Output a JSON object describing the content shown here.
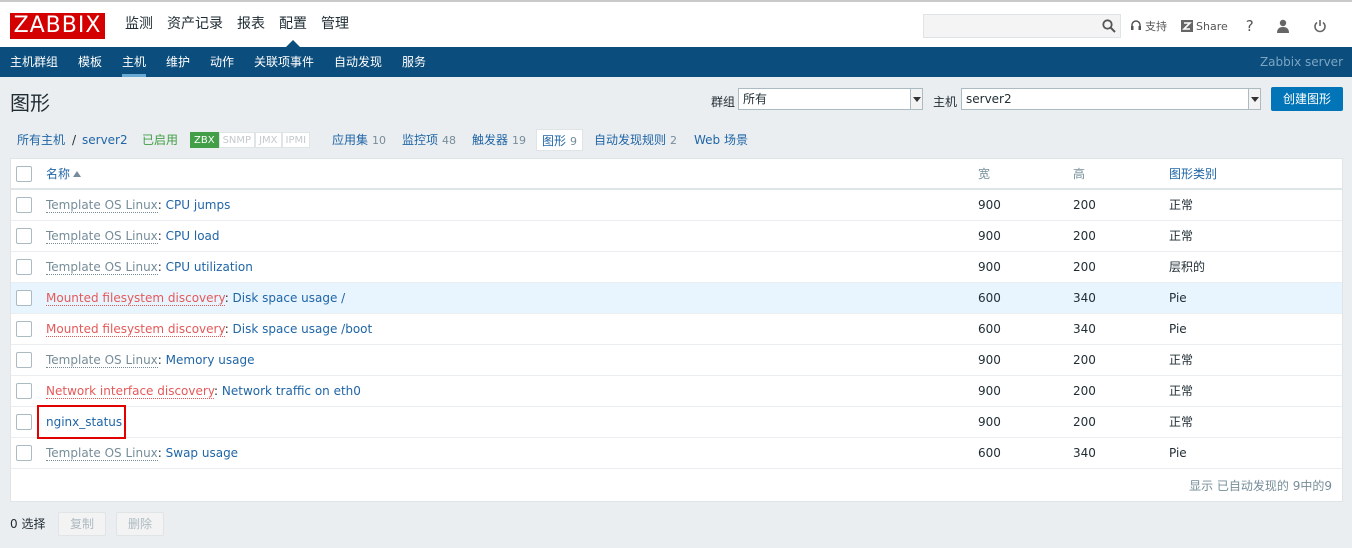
{
  "header": {
    "logo": "ZABBIX",
    "menu": [
      "监测",
      "资产记录",
      "报表",
      "配置",
      "管理"
    ],
    "selected_menu": "配置",
    "support": "支持",
    "share": "Share",
    "help": "?"
  },
  "nav": {
    "items": [
      "主机群组",
      "模板",
      "主机",
      "维护",
      "动作",
      "关联项事件",
      "自动发现",
      "服务"
    ],
    "selected": "主机",
    "server_name": "Zabbix server"
  },
  "page": {
    "title": "图形",
    "group_label": "群组",
    "group_value": "所有",
    "host_label": "主机",
    "host_value": "server2",
    "create_button": "创建图形"
  },
  "host_tabs": {
    "all_hosts": "所有主机",
    "separator": "/",
    "host": "server2",
    "status": "已启用",
    "badges": [
      {
        "label": "ZBX",
        "active": true
      },
      {
        "label": "SNMP",
        "active": false
      },
      {
        "label": "JMX",
        "active": false
      },
      {
        "label": "IPMI",
        "active": false
      }
    ],
    "applications": {
      "label": "应用集",
      "count": "10"
    },
    "items": {
      "label": "监控项",
      "count": "48"
    },
    "triggers": {
      "label": "触发器",
      "count": "19"
    },
    "graphs": {
      "label": "图形",
      "count": "9"
    },
    "discovery": {
      "label": "自动发现规则",
      "count": "2"
    },
    "web": {
      "label": "Web 场景"
    }
  },
  "table": {
    "columns": [
      "名称",
      "宽",
      "高",
      "图形类别"
    ],
    "rows": [
      {
        "prefix": "Template OS Linux",
        "prefix_type": "template",
        "name": "CPU jumps",
        "width": "900",
        "height": "200",
        "type": "正常"
      },
      {
        "prefix": "Template OS Linux",
        "prefix_type": "template",
        "name": "CPU load",
        "width": "900",
        "height": "200",
        "type": "正常"
      },
      {
        "prefix": "Template OS Linux",
        "prefix_type": "template",
        "name": "CPU utilization",
        "width": "900",
        "height": "200",
        "type": "层积的"
      },
      {
        "prefix": "Mounted filesystem discovery",
        "prefix_type": "discovery",
        "name": "Disk space usage /",
        "width": "600",
        "height": "340",
        "type": "Pie"
      },
      {
        "prefix": "Mounted filesystem discovery",
        "prefix_type": "discovery",
        "name": "Disk space usage /boot",
        "width": "600",
        "height": "340",
        "type": "Pie"
      },
      {
        "prefix": "Template OS Linux",
        "prefix_type": "template",
        "name": "Memory usage",
        "width": "900",
        "height": "200",
        "type": "正常"
      },
      {
        "prefix": "Network interface discovery",
        "prefix_type": "discovery",
        "name": "Network traffic on eth0",
        "width": "900",
        "height": "200",
        "type": "正常"
      },
      {
        "prefix": "",
        "prefix_type": "none",
        "name": "nginx_status",
        "width": "900",
        "height": "200",
        "type": "正常"
      },
      {
        "prefix": "Template OS Linux",
        "prefix_type": "template",
        "name": "Swap usage",
        "width": "600",
        "height": "340",
        "type": "Pie"
      }
    ],
    "footer": "显示 已自动发现的 9中的9"
  },
  "actions": {
    "selected_count": "0 选择",
    "copy": "复制",
    "delete": "删除"
  }
}
